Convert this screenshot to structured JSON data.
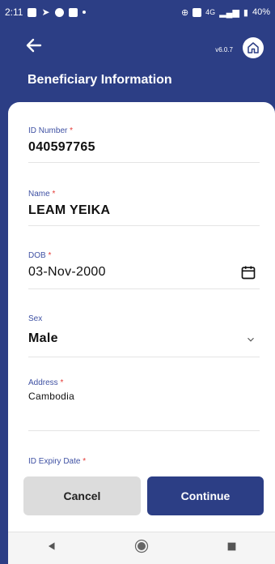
{
  "status_bar": {
    "time": "2:11",
    "network": "4G",
    "battery": "40%"
  },
  "header": {
    "version": "v6.0.7",
    "title": "Beneficiary Information"
  },
  "form": {
    "id_number": {
      "label": "ID Number",
      "value": "040597765"
    },
    "name": {
      "label": "Name",
      "value": "LEAM YEIKA"
    },
    "dob": {
      "label": "DOB",
      "value": "03-Nov-2000"
    },
    "sex": {
      "label": "Sex",
      "value": "Male"
    },
    "address": {
      "label": "Address",
      "value": "Cambodia"
    },
    "id_expiry": {
      "label": "ID Expiry Date"
    }
  },
  "actions": {
    "cancel": "Cancel",
    "continue": "Continue"
  },
  "colors": {
    "primary": "#2c3e85",
    "required": "#e53935",
    "label": "#3f51a3"
  }
}
